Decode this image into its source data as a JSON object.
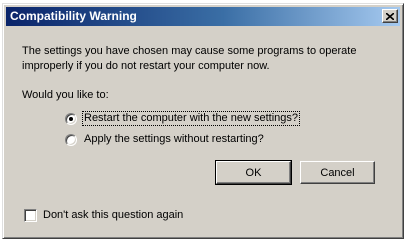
{
  "window": {
    "title": "Compatibility Warning",
    "close_icon": "close-icon"
  },
  "message": "The settings you have chosen may cause some programs to operate improperly if you do not restart your computer now.",
  "prompt": "Would you like to:",
  "options": [
    {
      "label": "Restart the computer with the new settings?",
      "selected": true
    },
    {
      "label": "Apply the settings without restarting?",
      "selected": false
    }
  ],
  "buttons": {
    "ok": "OK",
    "cancel": "Cancel"
  },
  "dont_ask": {
    "label": "Don't ask this question again",
    "checked": false
  }
}
